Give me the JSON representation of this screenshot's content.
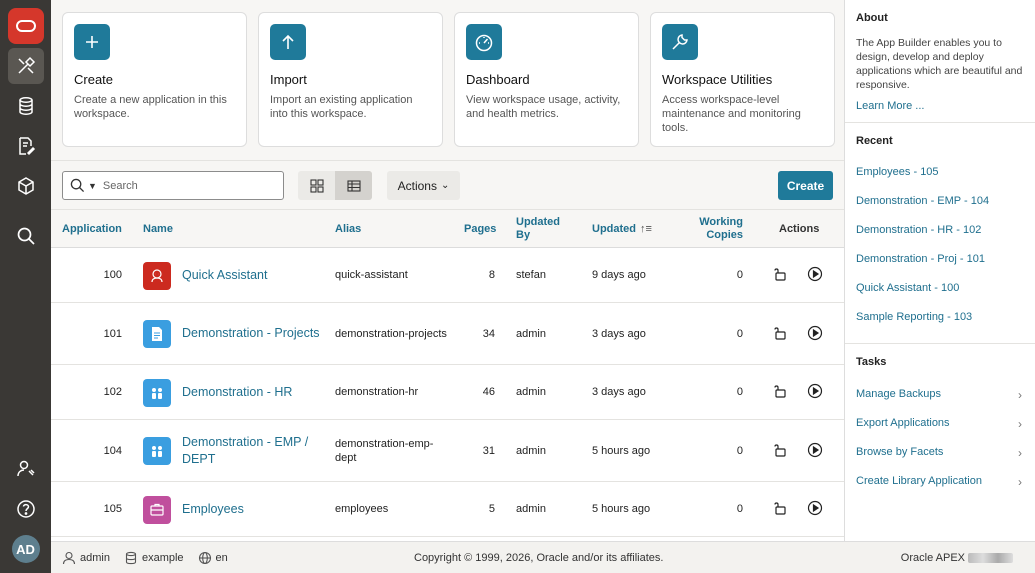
{
  "nav": {
    "items": [
      "logo",
      "app-builder",
      "sql-workshop",
      "team-development",
      "gallery",
      "search"
    ],
    "bottom": [
      "administration",
      "help"
    ],
    "avatar_initials": "AD"
  },
  "cards": [
    {
      "icon": "plus-icon",
      "title": "Create",
      "desc": "Create a new application in this workspace."
    },
    {
      "icon": "upload-icon",
      "title": "Import",
      "desc": "Import an existing application into this workspace."
    },
    {
      "icon": "gauge-icon",
      "title": "Dashboard",
      "desc": "View workspace usage, activity, and health metrics."
    },
    {
      "icon": "wrench-icon",
      "title": "Workspace Utilities",
      "desc": "Access workspace-level maintenance and monitoring tools."
    }
  ],
  "toolbar": {
    "search_placeholder": "Search",
    "actions_label": "Actions",
    "create_label": "Create"
  },
  "table": {
    "headers": {
      "application": "Application",
      "name": "Name",
      "alias": "Alias",
      "pages": "Pages",
      "updated_by": "Updated By",
      "updated": "Updated",
      "working_copies": "Working Copies",
      "actions": "Actions"
    },
    "rows": [
      {
        "id": "100",
        "name": "Quick Assistant",
        "alias": "quick-assistant",
        "pages": "8",
        "updated_by": "stefan",
        "updated": "9 days ago",
        "copies": "0",
        "icon_color": "#cc2a1f",
        "icon": "assistant-icon"
      },
      {
        "id": "101",
        "name": "Demonstration - Projects",
        "alias": "demonstration-projects",
        "pages": "34",
        "updated_by": "admin",
        "updated": "3 days ago",
        "copies": "0",
        "icon_color": "#3a9ee0",
        "icon": "document-icon"
      },
      {
        "id": "102",
        "name": "Demonstration - HR",
        "alias": "demonstration-hr",
        "pages": "46",
        "updated_by": "admin",
        "updated": "3 days ago",
        "copies": "0",
        "icon_color": "#3a9ee0",
        "icon": "people-icon"
      },
      {
        "id": "104",
        "name": "Demonstration - EMP / DEPT",
        "alias": "demonstration-emp-dept",
        "pages": "31",
        "updated_by": "admin",
        "updated": "5 hours ago",
        "copies": "0",
        "icon_color": "#3a9ee0",
        "icon": "people-icon"
      },
      {
        "id": "105",
        "name": "Employees",
        "alias": "employees",
        "pages": "5",
        "updated_by": "admin",
        "updated": "5 hours ago",
        "copies": "0",
        "icon_color": "#c04f9d",
        "icon": "badge-icon"
      }
    ]
  },
  "about": {
    "title": "About",
    "text": "The App Builder enables you to design, develop and deploy applications which are beautiful and responsive.",
    "link": "Learn More ..."
  },
  "recent": {
    "title": "Recent",
    "items": [
      "Employees - 105",
      "Demonstration - EMP - 104",
      "Demonstration - HR - 102",
      "Demonstration - Proj - 101",
      "Quick Assistant - 100",
      "Sample Reporting - 103"
    ]
  },
  "tasks": {
    "title": "Tasks",
    "items": [
      "Manage Backups",
      "Export Applications",
      "Browse by Facets",
      "Create Library Application"
    ]
  },
  "footer": {
    "user": "admin",
    "schema": "example",
    "lang": "en",
    "copyright": "Copyright © 1999, 2026, Oracle and/or its affiliates.",
    "version_label": "Oracle APEX"
  }
}
